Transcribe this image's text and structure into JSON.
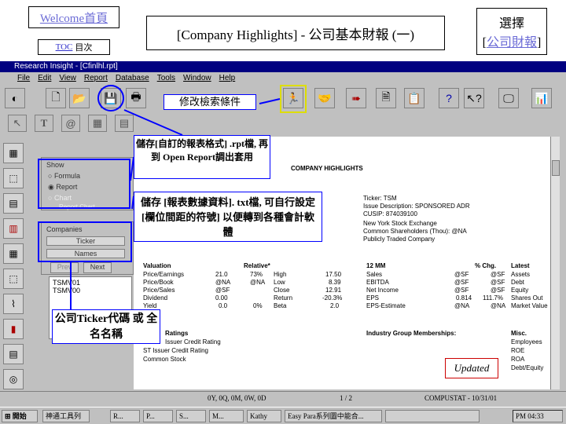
{
  "slide": {
    "welcome_link": "Welcome首頁",
    "toc_prefix": "TOC",
    "toc_suffix": "目次",
    "title": "[Company Highlights] - 公司基本財報 (一)",
    "select_label": "選擇",
    "select_link_open": "[",
    "select_link_text": "公司財報",
    "select_link_close": "]"
  },
  "window": {
    "title": "Research Insight - [Cfinlhl.rpt]",
    "menu": [
      "File",
      "Edit",
      "View",
      "Report",
      "Database",
      "Tools",
      "Window",
      "Help"
    ]
  },
  "callouts": {
    "modify": "修改檢索條件",
    "save": "儲存[自訂的報表格式] .rpt檔, 再到 Open Report調出套用",
    "export": "儲存 [報表數據資料]. txt檔, 可自行設定 [欄位間距的符號] 以便轉到各種會計軟體",
    "ticker": "公司Ticker代碼 或 全名名稱",
    "updated": "Updated"
  },
  "left_panel": {
    "show_label": "Show",
    "options": [
      "Formula",
      "Report",
      "Chart",
      "Report Chart"
    ],
    "selected_option": "Report",
    "companies_label": "Companies",
    "ticker_col": "Ticker",
    "names_col": "Names",
    "prev_btn": "Prev",
    "next_btn": "Next",
    "tickers": [
      "TSMV01",
      "TSMV00"
    ]
  },
  "report": {
    "header": "COMPANY HIGHLIGHTS",
    "ticker_line": "Ticker:   TSM",
    "issue_line": "Issue Description:   SPONSORED ADR",
    "cusip_line": "CUSIP:   874039100",
    "exchange": "New York Stock Exchange",
    "shareholders": "Common Shareholders (Thou):   @NA",
    "trading": "Publicly Traded Company",
    "valuation_header": "Valuation",
    "relative_header": "Relative*",
    "m12_header": "12 MM",
    "pctchg_header": "% Chg.",
    "latest_header": "Latest",
    "valuation_rows": [
      [
        "Price/Earnings",
        "21.0",
        "73%",
        "High",
        "17.50"
      ],
      [
        "Price/Book",
        "@NA",
        "@NA",
        "Low",
        "8.39"
      ],
      [
        "Price/Sales",
        "@SF",
        "",
        "Close",
        "12.91"
      ],
      [
        "Dividend",
        "0.00",
        "",
        "Return",
        "-20.3%"
      ],
      [
        "Yield",
        "0.0",
        "0%",
        "Beta",
        "2.0"
      ]
    ],
    "m12_rows": [
      [
        "Sales",
        "@SF",
        "@SF",
        "Assets"
      ],
      [
        "EBITDA",
        "@SF",
        "@SF",
        "Debt"
      ],
      [
        "Net Income",
        "@SF",
        "@SF",
        "Equity"
      ],
      [
        "EPS",
        "0.814",
        "111.7%",
        "Shares Out"
      ],
      [
        "EPS-Estimate",
        "@NA",
        "@NA",
        "Market Value"
      ]
    ],
    "ratings_header": "Ratings",
    "ratings": [
      "Issuer Credit Rating",
      "ST Issuer Credit Rating",
      "Common Stock"
    ],
    "industry_header": "Industry Group Memberships:",
    "misc_header": "Misc.",
    "misc": [
      "Employees",
      "ROE",
      "ROA",
      "Debt/Equity"
    ]
  },
  "statusbar": {
    "period": "0Y, 0Q, 0M, 0W, 0D",
    "page": "1 / 2",
    "db": "COMPUSTAT - 10/31/01"
  },
  "taskbar": {
    "start": "開始",
    "items": [
      "神通工具列",
      "R...",
      "P...",
      "S...",
      "M...",
      "Kathy",
      "Easy Para系列圖中能合...",
      ""
    ],
    "clock": "PM 04:33"
  }
}
